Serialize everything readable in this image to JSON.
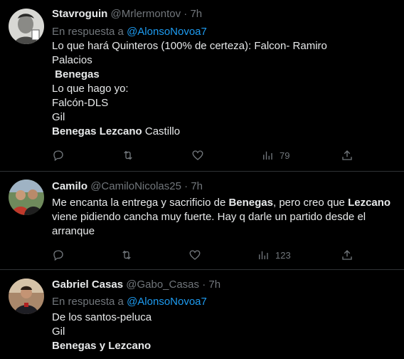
{
  "tweets": [
    {
      "name": "Stavroguin",
      "handle": "@Mrlermontov",
      "sep": "·",
      "time": "7h",
      "reply_prefix": "En respuesta a",
      "reply_to": "@AlonsoNovoa7",
      "lines": [
        "Lo que hará Quinteros (100% de certeza): Falcon- Ramiro",
        "Palacios",
        " Benegas",
        "Lo que hago yo:",
        "Falcón-DLS",
        "Gil",
        "Benegas Lezcano",
        " Castillo"
      ],
      "views": "79"
    },
    {
      "name": "Camilo",
      "handle": "@CamiloNicolas25",
      "sep": "·",
      "time": "7h",
      "lines": [
        "Me encanta la entrega y sacrificio de ",
        "Benegas",
        ", pero creo que ",
        "Lezcano",
        "viene pidiendo cancha muy fuerte. Hay q darle un partido desde el",
        "arranque"
      ],
      "views": "123"
    },
    {
      "name": "Gabriel Casas",
      "handle": "@Gabo_Casas",
      "sep": "·",
      "time": "7h",
      "reply_prefix": "En respuesta a",
      "reply_to": "@AlonsoNovoa7",
      "lines": [
        "De los santos-peluca",
        "Gil",
        "Benegas y Lezcano"
      ]
    }
  ],
  "colors": {
    "background": "#000000",
    "text": "#e7e9ea",
    "muted": "#71767b",
    "link": "#1d9bf0",
    "divider": "#2f3336"
  },
  "icons": [
    "reply-icon",
    "retweet-icon",
    "like-icon",
    "views-icon",
    "share-icon"
  ]
}
